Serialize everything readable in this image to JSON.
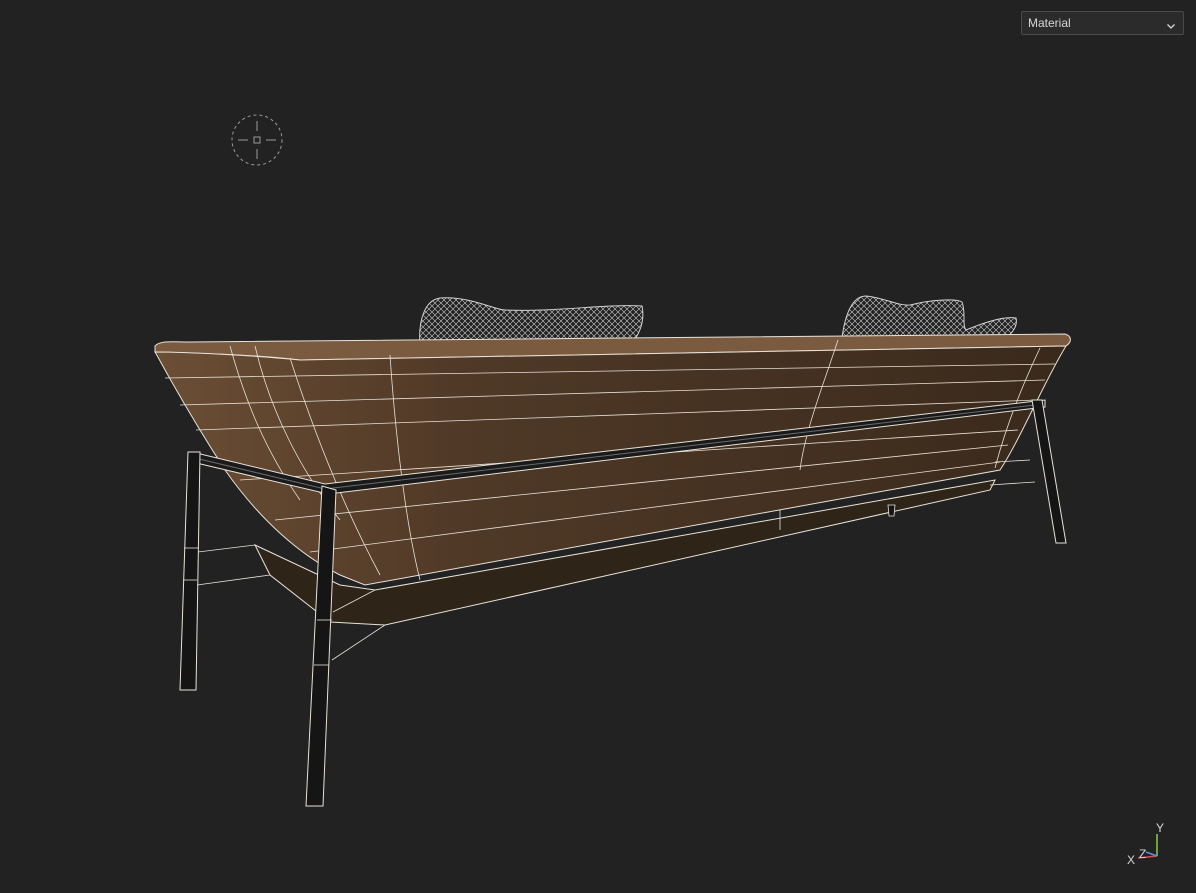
{
  "viewport": {
    "background": "#222222",
    "shading_mode": {
      "selected": "Material",
      "icon": "chevron-down-icon"
    },
    "pivot_icon": "crosshair-icon",
    "axis_gizmo": {
      "x_label": "X",
      "y_label": "Y",
      "z_label": "Z",
      "x_color": "#d94c4c",
      "y_color": "#7fd14a",
      "z_color": "#5b8fe0"
    },
    "model": {
      "body_color": "#6b4e35",
      "wire_color": "#e8e2d8",
      "frame_color": "#1a1a1a"
    }
  }
}
